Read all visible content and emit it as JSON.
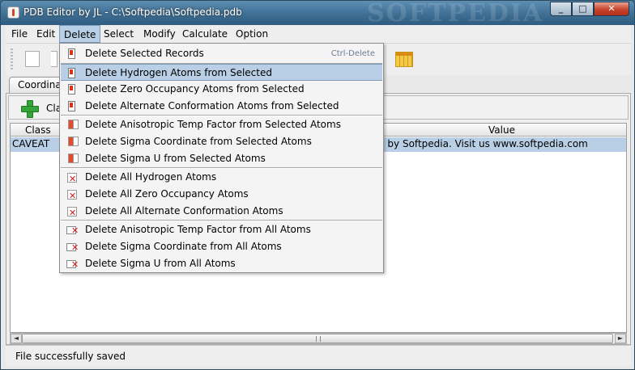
{
  "window": {
    "title": "PDB Editor by JL - C:\\Softpedia\\Softpedia.pdb",
    "watermark": "SOFTPEDIA",
    "minimize": "_",
    "maximize": "□",
    "close": "✕"
  },
  "menubar": {
    "items": [
      "File",
      "Edit",
      "Delete",
      "Select",
      "Modify",
      "Calculate",
      "Option"
    ],
    "active": "Delete"
  },
  "tabs": {
    "active_label": "Coordina"
  },
  "subbar": {
    "label": "Cla"
  },
  "table": {
    "columns": [
      "Class",
      "Value"
    ],
    "rows": [
      {
        "class": "CAVEAT",
        "value": "d by Softpedia. Visit us www.softpedia.com"
      }
    ]
  },
  "scrollbar": {
    "left_arrow": "◄",
    "right_arrow": "►"
  },
  "status": {
    "text": "File successfully saved"
  },
  "delete_menu": {
    "items": [
      {
        "label": "Delete Selected Records",
        "accel": "Ctrl-Delete",
        "icon": "doc-icon"
      },
      {
        "label": "Delete Hydrogen Atoms from Selected",
        "icon": "doc-icon",
        "highlighted": true
      },
      {
        "label": "Delete Zero Occupancy Atoms from Selected",
        "icon": "doc-icon"
      },
      {
        "label": "Delete Alternate Conformation Atoms from Selected",
        "icon": "doc-icon"
      },
      {
        "label": "Delete Anisotropic Temp Factor from Selected Atoms",
        "icon": "pair-icon"
      },
      {
        "label": "Delete Sigma Coordinate from Selected Atoms",
        "icon": "pair-icon"
      },
      {
        "label": "Delete Sigma U from Selected Atoms",
        "icon": "pair-icon"
      },
      {
        "label": "Delete All Hydrogen Atoms",
        "icon": "x-icon"
      },
      {
        "label": "Delete All Zero Occupancy Atoms",
        "icon": "x-icon"
      },
      {
        "label": "Delete All Alternate Conformation Atoms",
        "icon": "x-icon"
      },
      {
        "label": "Delete Anisotropic Temp Factor from All Atoms",
        "icon": "doc-x-icon"
      },
      {
        "label": "Delete Sigma Coordinate from All Atoms",
        "icon": "doc-x-icon"
      },
      {
        "label": "Delete Sigma U from All Atoms",
        "icon": "doc-x-icon"
      }
    ]
  }
}
